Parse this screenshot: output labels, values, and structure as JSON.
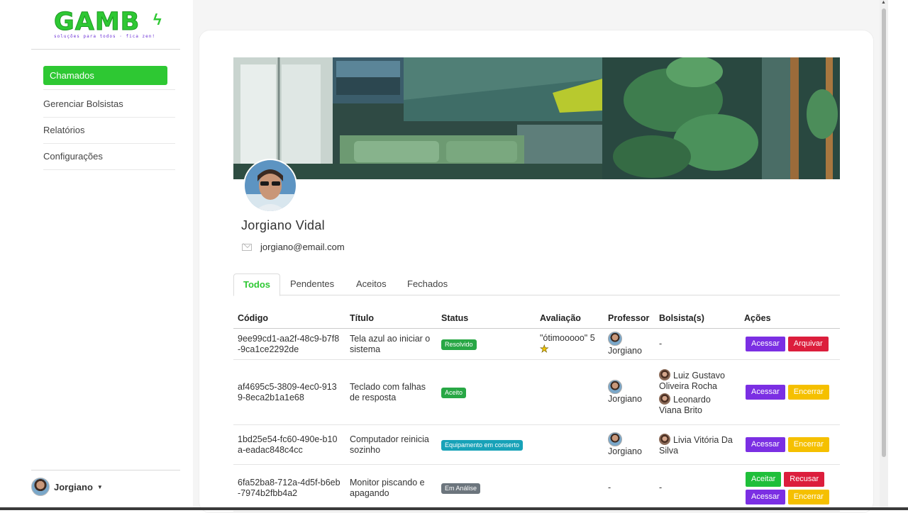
{
  "logo": {
    "text": "GAMB",
    "tagline": "soluções para todos · fica zen!"
  },
  "sidebar": {
    "active_item": "Chamados",
    "items": [
      "Gerenciar Bolsistas",
      "Relatórios",
      "Configurações"
    ],
    "user_name": "Jorgiano"
  },
  "profile": {
    "name": "Jorgiano Vidal",
    "email": "jorgiano@email.com"
  },
  "tabs": [
    "Todos",
    "Pendentes",
    "Aceitos",
    "Fechados"
  ],
  "active_tab": "Todos",
  "table": {
    "headers": [
      "Código",
      "Título",
      "Status",
      "Avaliação",
      "Professor",
      "Bolsista(s)",
      "Ações"
    ],
    "rows": [
      {
        "codigo": "9ee99cd1-aa2f-48c9-b7f8-9ca1ce2292de",
        "titulo": "Tela azul ao iniciar o sistema",
        "status": "Resolvido",
        "status_color": "#28a745",
        "avaliacao": "\"ótimooooo\" 5",
        "professor": "Jorgiano",
        "bolsista_text": "-",
        "bolsistas": [],
        "acoes": [
          {
            "label": "Acessar",
            "color": "#7b2fe3"
          },
          {
            "label": "Arquivar",
            "color": "#dc1e3c"
          }
        ]
      },
      {
        "codigo": "af4695c5-3809-4ec0-9139-8eca2b1a1e68",
        "titulo": "Teclado com falhas de resposta",
        "status": "Aceito",
        "status_color": "#28a745",
        "avaliacao": "",
        "professor": "Jorgiano",
        "bolsista_text": "",
        "bolsistas": [
          "Luiz Gustavo Oliveira Rocha",
          "Leonardo Viana Brito"
        ],
        "acoes": [
          {
            "label": "Acessar",
            "color": "#7b2fe3"
          },
          {
            "label": "Encerrar",
            "color": "#f5c000"
          }
        ]
      },
      {
        "codigo": "1bd25e54-fc60-490e-b10a-eadac848c4cc",
        "titulo": "Computador reinicia sozinho",
        "status": "Equipamento em conserto",
        "status_color": "#18a2b8",
        "avaliacao": "",
        "professor": "Jorgiano",
        "bolsista_text": "",
        "bolsistas": [
          "Livia Vitória Da Silva"
        ],
        "acoes": [
          {
            "label": "Acessar",
            "color": "#7b2fe3"
          },
          {
            "label": "Encerrar",
            "color": "#f5c000"
          }
        ]
      },
      {
        "codigo": "6fa52ba8-712a-4d5f-b6eb-7974b2fbb4a2",
        "titulo": "Monitor piscando e apagando",
        "status": "Em Análise",
        "status_color": "#6c757d",
        "avaliacao": "",
        "professor": "-",
        "bolsista_text": "-",
        "bolsistas": [],
        "acoes": [
          {
            "label": "Aceitar",
            "color": "#1fbf3a"
          },
          {
            "label": "Recusar",
            "color": "#dc1e3c"
          },
          {
            "label": "Acessar",
            "color": "#7b2fe3"
          },
          {
            "label": "Encerrar",
            "color": "#f5c000"
          }
        ]
      }
    ]
  },
  "colors": {
    "brand": "#2ec833",
    "sidebar_bg": "#ffffff",
    "page_bg": "#f5f5f5"
  }
}
